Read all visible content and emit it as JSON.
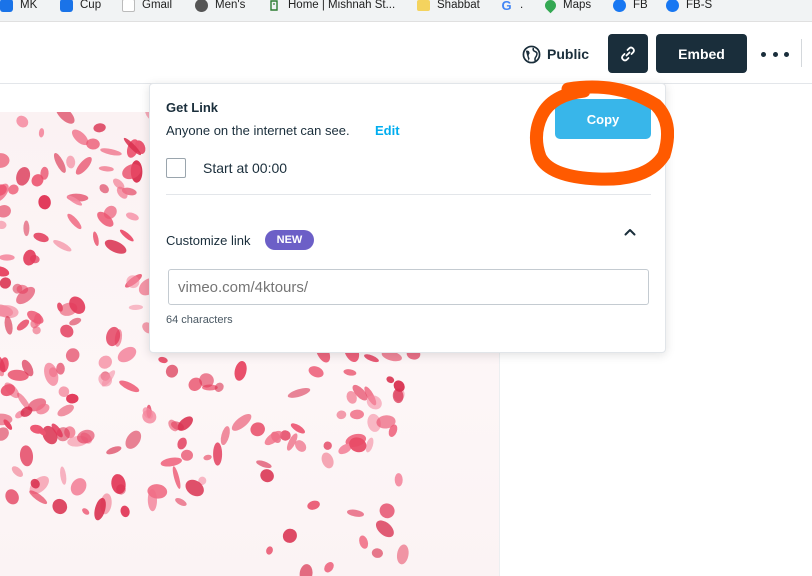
{
  "bookmarks": [
    {
      "label": "MK",
      "icon": "mk-icon"
    },
    {
      "label": "Cup",
      "icon": "cup-icon"
    },
    {
      "label": "Gmail",
      "icon": "gmail-icon"
    },
    {
      "label": "Men's",
      "icon": "globe-icon"
    },
    {
      "label": "Home | Mishnah St...",
      "icon": "home-icon"
    },
    {
      "label": "Shabbat",
      "icon": "folder-icon"
    },
    {
      "label": ".",
      "icon": "google-icon"
    },
    {
      "label": "Maps",
      "icon": "maps-icon"
    },
    {
      "label": "FB",
      "icon": "facebook-icon"
    },
    {
      "label": "FB-S",
      "icon": "facebook-icon"
    }
  ],
  "toolbar": {
    "public_label": "Public",
    "embed_label": "Embed"
  },
  "popover": {
    "title": "Get Link",
    "subtitle": "Anyone on the internet can see.",
    "edit_label": "Edit",
    "copy_label": "Copy",
    "start_at_label": "Start at 00:00",
    "start_at_checked": false,
    "customize_label": "Customize link",
    "new_badge": "NEW",
    "link_placeholder": "vimeo.com/4ktours/",
    "char_count": "64 characters"
  },
  "colors": {
    "dark_button": "#1a2e3b",
    "copy_button": "#38b6ea",
    "edit_link": "#00adef",
    "new_badge": "#6c5fc7",
    "annotation": "#ff5a00"
  }
}
